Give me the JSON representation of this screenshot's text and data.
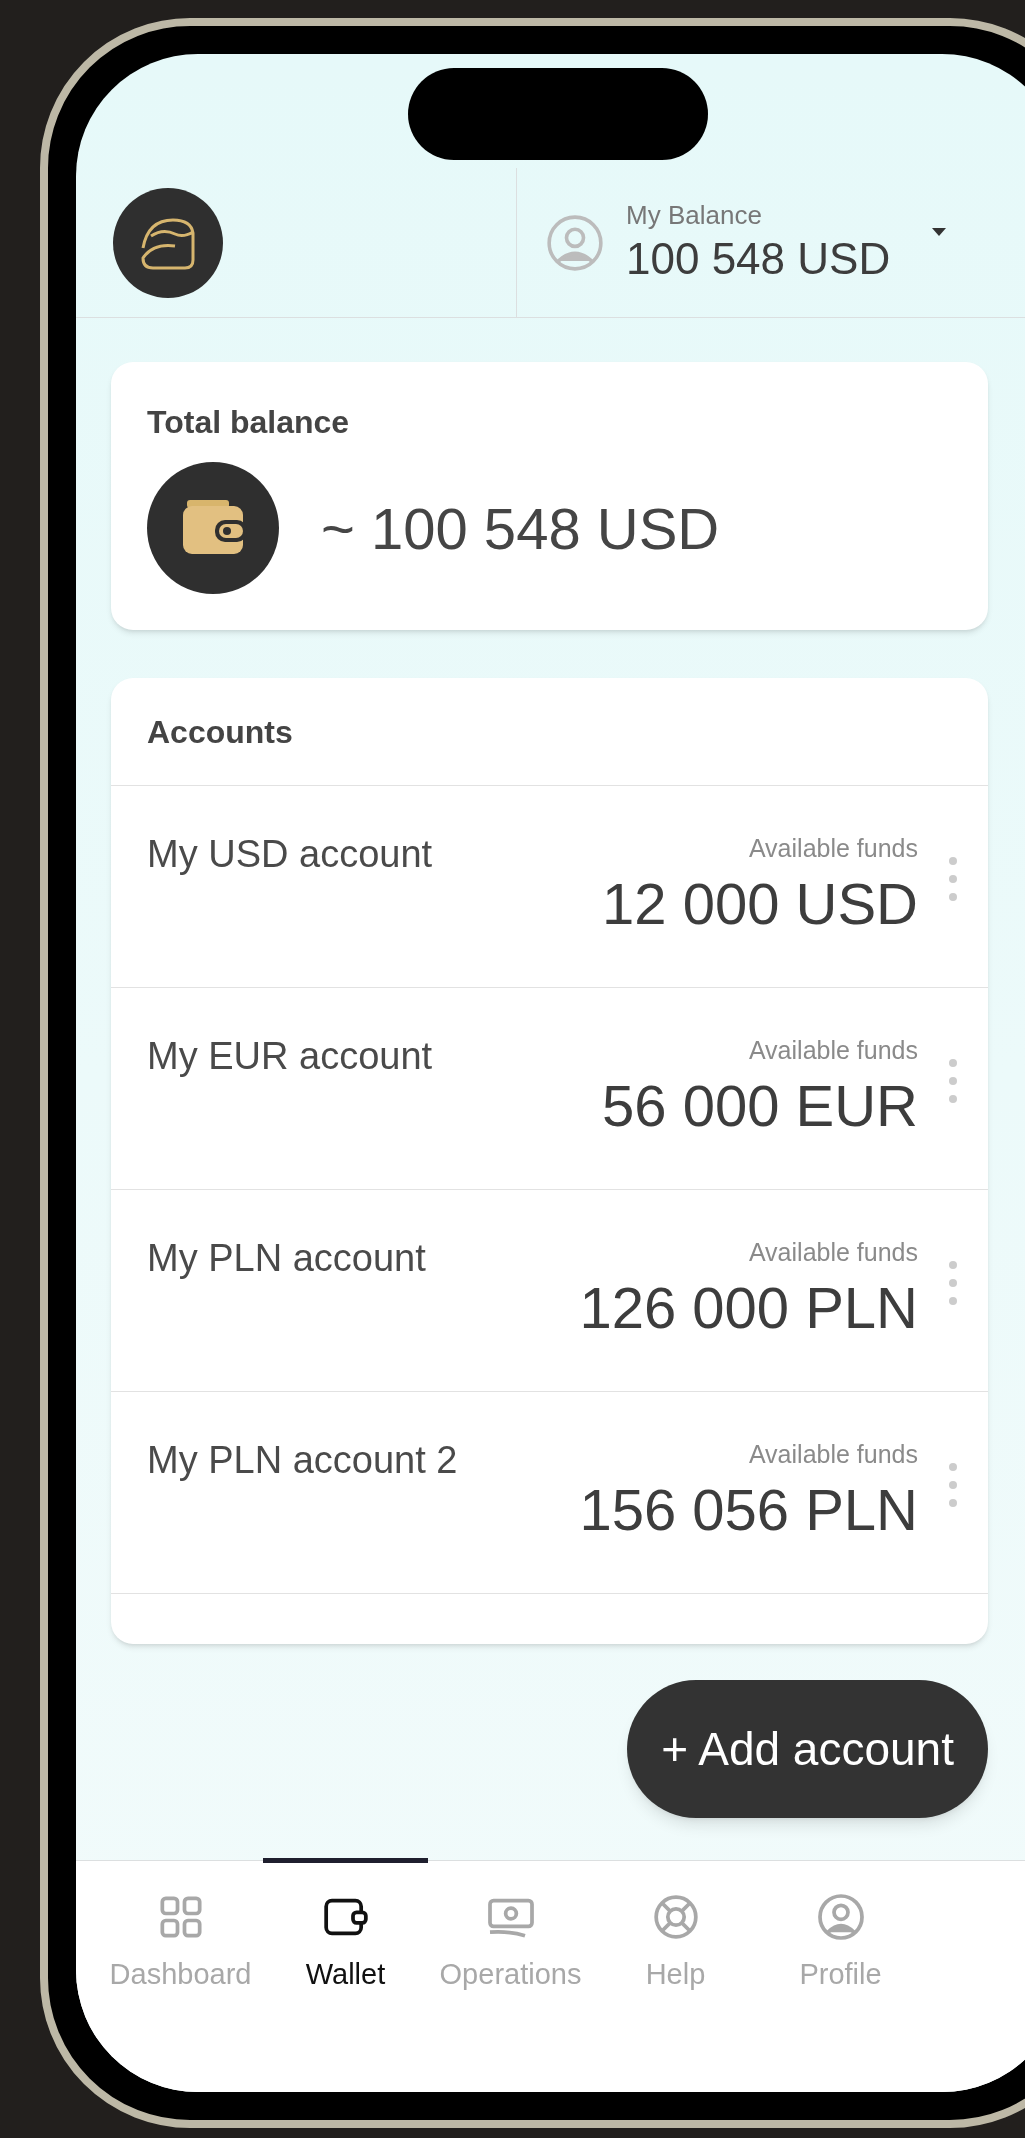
{
  "header": {
    "balance_label": "My Balance",
    "balance_amount": "100 548 USD"
  },
  "total_balance": {
    "title": "Total balance",
    "amount": "~ 100 548 USD"
  },
  "accounts": {
    "title": "Accounts",
    "items": [
      {
        "name": "My USD account",
        "funds_label": "Available funds",
        "amount": "12 000 USD"
      },
      {
        "name": "My EUR account",
        "funds_label": "Available funds",
        "amount": "56 000 EUR"
      },
      {
        "name": "My PLN account",
        "funds_label": "Available funds",
        "amount": "126 000 PLN"
      },
      {
        "name": "My PLN account 2",
        "funds_label": "Available funds",
        "amount": "156 056 PLN"
      }
    ]
  },
  "add_button": "+ Add account",
  "nav": [
    {
      "kind": "dashboard",
      "label": "Dashboard",
      "selected": false
    },
    {
      "kind": "wallet",
      "label": "Wallet",
      "selected": true
    },
    {
      "kind": "operations",
      "label": "Operations",
      "selected": false
    },
    {
      "kind": "help",
      "label": "Help",
      "selected": false
    },
    {
      "kind": "profile",
      "label": "Profile",
      "selected": false
    }
  ]
}
